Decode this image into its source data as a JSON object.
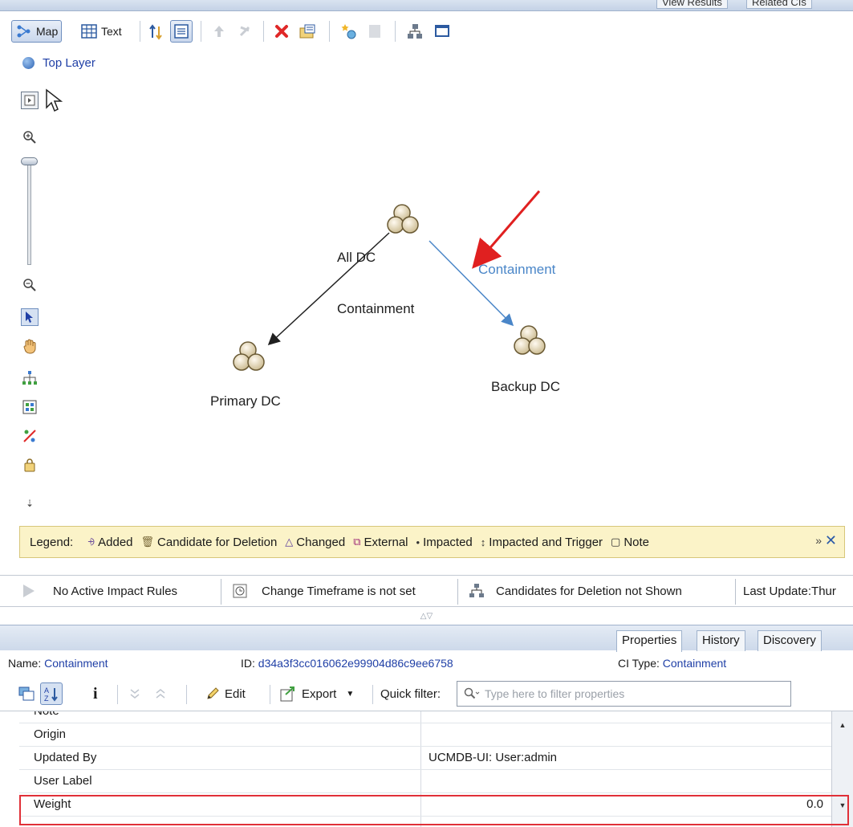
{
  "top_tabs": [
    "View Results",
    "Related CIs"
  ],
  "toolbar": {
    "map_label": "Map",
    "text_label": "Text"
  },
  "breadcrumb": {
    "label": "Top Layer"
  },
  "map": {
    "nodes": [
      {
        "label": "All DC"
      },
      {
        "label": "Primary DC"
      },
      {
        "label": "Backup DC"
      }
    ],
    "edges": [
      {
        "label": "Containment",
        "color": "#202020"
      },
      {
        "label": "Containment",
        "color": "#4a86c8"
      }
    ],
    "annotation_arrow_color": "#e02020"
  },
  "legend": {
    "title": "Legend:",
    "items": [
      {
        "icon": "added-icon",
        "label": "Added"
      },
      {
        "icon": "candidate-deletion-icon",
        "label": "Candidate for Deletion"
      },
      {
        "icon": "changed-icon",
        "label": "Changed"
      },
      {
        "icon": "external-icon",
        "label": "External"
      },
      {
        "icon": "impacted-icon",
        "label": "Impacted"
      },
      {
        "icon": "impacted-trigger-icon",
        "label": "Impacted and Trigger"
      },
      {
        "icon": "note-icon",
        "label": "Note"
      }
    ],
    "more": "»",
    "close": "✕"
  },
  "status_bar": {
    "impact_rules": "No Active Impact Rules",
    "timeframe": "Change Timeframe is not set",
    "candidates": "Candidates for Deletion not Shown",
    "last_update": "Last Update:Thur"
  },
  "properties_panel": {
    "tabs": [
      "Properties",
      "History",
      "Discovery"
    ],
    "active_tab": "Properties",
    "name_key": "Name:",
    "name_value": "Containment",
    "id_key": "ID:",
    "id_value": "d34a3f3cc016062e99904d86c9ee6758",
    "ci_type_key": "CI Type:",
    "ci_type_value": "Containment",
    "toolbar": {
      "edit_label": "Edit",
      "export_label": "Export",
      "quick_filter_label": "Quick filter:",
      "filter_placeholder": "Type here to filter properties"
    },
    "rows": [
      {
        "key": "Note",
        "value": ""
      },
      {
        "key": "Origin",
        "value": ""
      },
      {
        "key": "Updated By",
        "value": "UCMDB-UI: User:admin"
      },
      {
        "key": "User Label",
        "value": ""
      },
      {
        "key": "Weight",
        "value": "0.0"
      }
    ],
    "highlight_color": "#e03038"
  }
}
